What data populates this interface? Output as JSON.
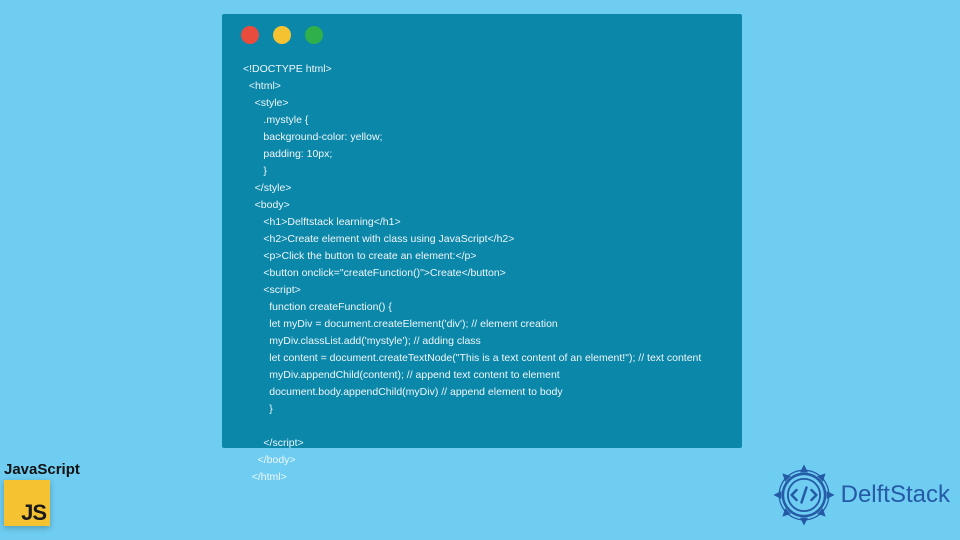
{
  "code_lines": [
    "<!DOCTYPE html>",
    "  <html>",
    "    <style>",
    "       .mystyle {",
    "       background-color: yellow;",
    "       padding: 10px;",
    "       }",
    "    </style>",
    "    <body>",
    "       <h1>Delftstack learning</h1>",
    "       <h2>Create element with class using JavaScript</h2>",
    "       <p>Click the button to create an element:</p>",
    "       <button onclick=\"createFunction()\">Create</button>",
    "       <script>",
    "         function createFunction() {",
    "         let myDiv = document.createElement('div'); // element creation",
    "         myDiv.classList.add('mystyle'); // adding class",
    "         let content = document.createTextNode(\"This is a text content of an element!\"); // text content",
    "         myDiv.appendChild(content); // append text content to element",
    "         document.body.appendChild(myDiv) // append element to body",
    "         }",
    "",
    "       </script>",
    "     </body>",
    "   </html>"
  ],
  "js_badge": {
    "label": "JavaScript",
    "logo_text": "JS"
  },
  "brand": {
    "name": "DelftStack"
  },
  "colors": {
    "page_bg": "#6fcdf1",
    "window_bg": "#0b87a9",
    "brand": "#245aa6"
  }
}
